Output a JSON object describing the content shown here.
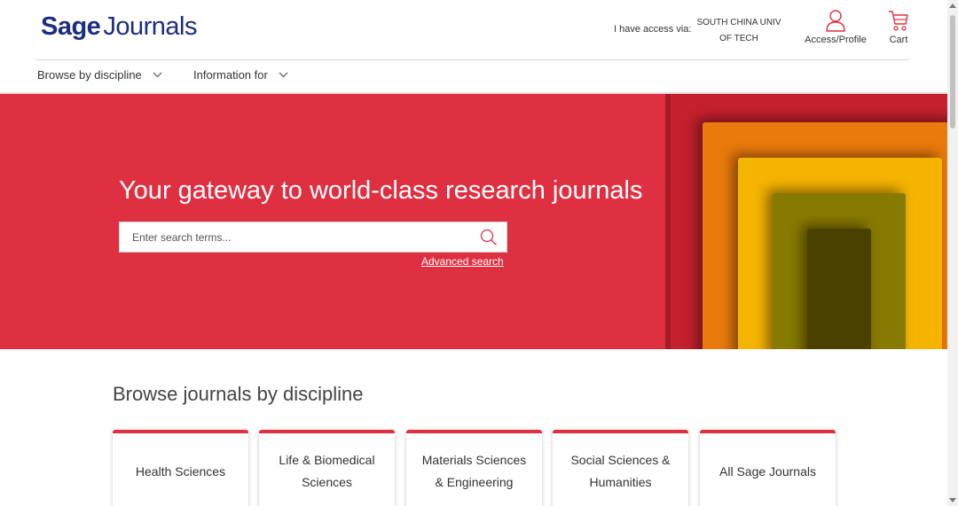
{
  "header": {
    "logo_sage": "Sage",
    "logo_journals": "Journals",
    "access_label": "I have access via:",
    "institution_line1": "SOUTH CHINA UNIV",
    "institution_line2": "OF TECH",
    "profile_label": "Access/Profile",
    "cart_label": "Cart"
  },
  "nav": {
    "browse_label": "Browse by discipline",
    "info_label": "Information for"
  },
  "hero": {
    "title": "Your gateway to world-class research journals",
    "search_placeholder": "Enter search terms...",
    "advanced_search": "Advanced search"
  },
  "disciplines": {
    "title": "Browse journals by discipline",
    "cards": [
      {
        "line1": "Health Sciences",
        "line2": ""
      },
      {
        "line1": "Life & Biomedical",
        "line2": "Sciences"
      },
      {
        "line1": "Materials Sciences",
        "line2": "& Engineering"
      },
      {
        "line1": "Social Sciences &",
        "line2": "Humanities"
      },
      {
        "line1": "All Sage Journals",
        "line2": ""
      }
    ]
  },
  "colors": {
    "brand_navy": "#1d2d80",
    "hero_red": "#df3041",
    "art_orange": "#e97a0b",
    "art_yellow": "#f5b400",
    "art_olive": "#877a00",
    "art_dark": "#4a4000"
  },
  "icons": [
    "user-icon",
    "cart-icon",
    "chevron-down-icon",
    "search-icon"
  ]
}
